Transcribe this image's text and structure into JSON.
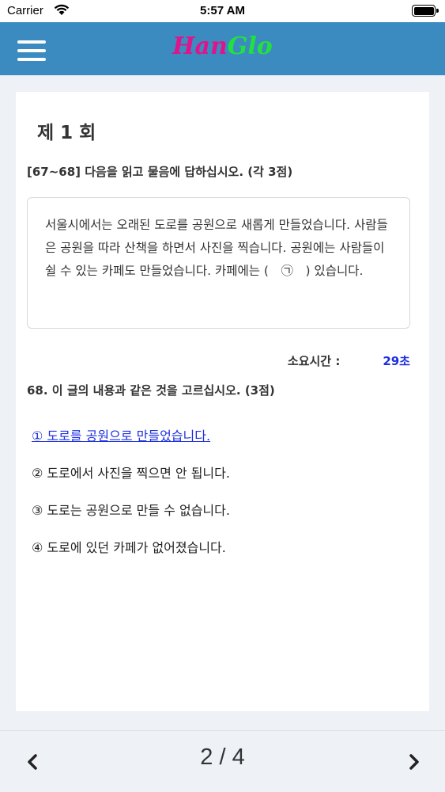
{
  "status_bar": {
    "carrier": "Carrier",
    "time": "5:57 AM",
    "icons": [
      "wifi-icon",
      "battery-icon"
    ]
  },
  "header": {
    "logo_part1": "Han",
    "logo_part2": "Glo",
    "menu_icon": "hamburger-menu-icon",
    "colors": {
      "bar": "#3b8bc0",
      "logo_han": "#e0148a",
      "logo_glo": "#22e040"
    }
  },
  "exam": {
    "round_title": "제 1 회",
    "instruction": "[67~68] 다음을 읽고 물음에 답하십시오. (각 3점)",
    "passage": "서울시에서는 오래된 도로를 공원으로 새롭게 만들었습니다. 사람들은 공원을 따라 산책을 하면서 사진을 찍습니다. 공원에는 사람들이 쉴 수 있는 카페도 만들었습니다. 카페에는 (　㉠　) 있습니다.",
    "timer_label": "소요시간  :",
    "timer_value": "29초",
    "question": "68. 이 글의 내용과 같은 것을 고르십시오. (3점)",
    "options": [
      {
        "label": "① 도로를 공원으로 만들었습니다.",
        "selected": true
      },
      {
        "label": "② 도로에서 사진을 찍으면 안 됩니다.",
        "selected": false
      },
      {
        "label": "③ 도로는 공원으로 만들 수 없습니다.",
        "selected": false
      },
      {
        "label": "④ 도로에 있던 카페가 없어졌습니다.",
        "selected": false
      }
    ],
    "colors": {
      "selected_option": "#1c2ee0",
      "timer_value": "#1c2ee0"
    }
  },
  "pagination": {
    "current": 2,
    "total": 4,
    "text": "2 / 4",
    "prev_icon": "chevron-left-icon",
    "next_icon": "chevron-right-icon"
  }
}
